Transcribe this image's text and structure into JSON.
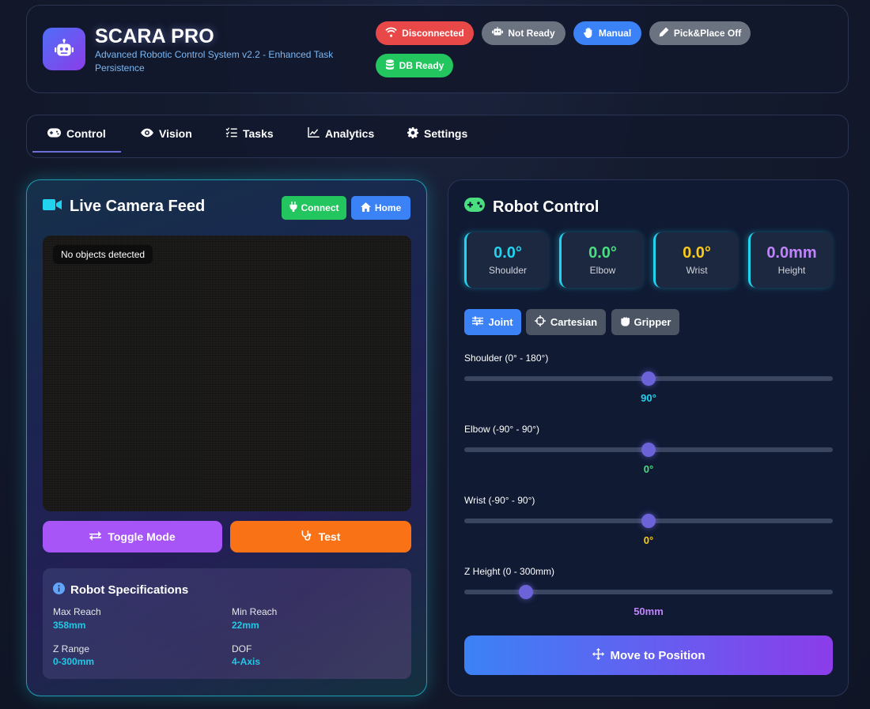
{
  "header": {
    "title": "SCARA PRO",
    "subtitle": "Advanced Robotic Control System v2.2 - Enhanced Task Persistence",
    "logo_icon": "robot-icon",
    "badges": [
      {
        "label": "Disconnected",
        "icon": "wifi-icon",
        "color": "#e94848"
      },
      {
        "label": "Not Ready",
        "icon": "robot-icon",
        "color": "#6b7280"
      },
      {
        "label": "Manual",
        "icon": "hand-icon",
        "color": "#3b82f6"
      },
      {
        "label": "Pick&Place Off",
        "icon": "pencil-icon",
        "color": "#6b7280"
      },
      {
        "label": "DB Ready",
        "icon": "database-icon",
        "color": "#22c55e"
      }
    ]
  },
  "tabs": [
    {
      "label": "Control",
      "icon": "gamepad-icon",
      "active": true
    },
    {
      "label": "Vision",
      "icon": "eye-icon",
      "active": false
    },
    {
      "label": "Tasks",
      "icon": "tasks-icon",
      "active": false
    },
    {
      "label": "Analytics",
      "icon": "chart-line-icon",
      "active": false
    },
    {
      "label": "Settings",
      "icon": "gear-icon",
      "active": false
    }
  ],
  "camera": {
    "title": "Live Camera Feed",
    "connect_label": "Connect",
    "home_label": "Home",
    "detection_status": "No objects detected",
    "toggle_mode_label": "Toggle Mode",
    "test_label": "Test",
    "colors": {
      "connect": "#22c55e",
      "home": "#3b82f6",
      "toggle": "#a855f7",
      "test": "#f97316"
    }
  },
  "specs": {
    "title": "Robot Specifications",
    "items": [
      {
        "label": "Max Reach",
        "value": "358mm"
      },
      {
        "label": "Min Reach",
        "value": "22mm"
      },
      {
        "label": "Z Range",
        "value": "0-300mm"
      },
      {
        "label": "DOF",
        "value": "4-Axis"
      }
    ]
  },
  "control": {
    "title": "Robot Control",
    "joints": [
      {
        "value": "0.0°",
        "label": "Shoulder",
        "color": "#22d3ee"
      },
      {
        "value": "0.0°",
        "label": "Elbow",
        "color": "#4ade80"
      },
      {
        "value": "0.0°",
        "label": "Wrist",
        "color": "#facc15"
      },
      {
        "value": "0.0mm",
        "label": "Height",
        "color": "#c084fc"
      }
    ],
    "modes": [
      {
        "label": "Joint",
        "icon": "sliders-icon",
        "active": true
      },
      {
        "label": "Cartesian",
        "icon": "crosshairs-icon",
        "active": false
      },
      {
        "label": "Gripper",
        "icon": "hand-grab-icon",
        "active": false
      }
    ],
    "sliders": [
      {
        "label": "Shoulder (0° - 180°)",
        "value": "90°",
        "fraction": 0.5,
        "color": "#22d3ee"
      },
      {
        "label": "Elbow (-90° - 90°)",
        "value": "0°",
        "fraction": 0.5,
        "color": "#4ade80"
      },
      {
        "label": "Wrist (-90° - 90°)",
        "value": "0°",
        "fraction": 0.5,
        "color": "#facc15"
      },
      {
        "label": "Z Height (0 - 300mm)",
        "value": "50mm",
        "fraction": 0.1667,
        "color": "#c084fc"
      }
    ],
    "move_label": "Move to Position"
  }
}
